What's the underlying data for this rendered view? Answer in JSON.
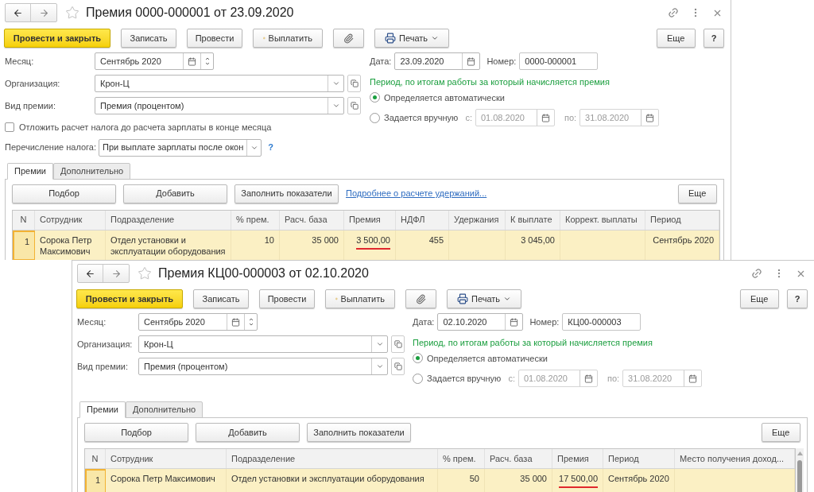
{
  "windows": [
    {
      "title": "Премия 0000-000001 от 23.09.2020",
      "toolbar": [
        {
          "kind": "primary",
          "label": "Провести и закрыть"
        },
        {
          "kind": "plain",
          "label": "Записать"
        },
        {
          "kind": "plain",
          "label": "Провести"
        },
        {
          "kind": "pay",
          "label": "Выплатить"
        },
        {
          "kind": "attach"
        },
        {
          "kind": "print",
          "label": "Печать"
        }
      ],
      "more": "Еще",
      "help": "?",
      "fields": [
        {
          "kind": "month",
          "label": "Месяц:",
          "value": "Сентябрь 2020"
        },
        {
          "kind": "ref",
          "label": "Организация:",
          "value": "Крон-Ц"
        },
        {
          "kind": "ref",
          "label": "Вид премии:",
          "value": "Премия (процентом)"
        }
      ],
      "checkbox": {
        "label": "Отложить расчет налога до расчета зарплаты в конце месяца",
        "checked": false
      },
      "tax_transfer": {
        "label": "Перечисление налога:",
        "value": "При выплате зарплаты после окон",
        "help": "?"
      },
      "date": {
        "label": "Дата:",
        "value": "23.09.2020"
      },
      "number": {
        "label": "Номер:",
        "value": "0000-000001"
      },
      "period": {
        "heading": "Период, по итогам работы за который начисляется премия",
        "options": [
          {
            "label": "Определяется автоматически",
            "selected": true
          },
          {
            "label": "Задается вручную",
            "selected": false
          }
        ],
        "from_label": "с:",
        "from": "01.08.2020",
        "to_label": "по:",
        "to": "31.08.2020"
      },
      "tabs": [
        {
          "label": "Премии",
          "selected": true
        },
        {
          "label": "Дополнительно",
          "selected": false
        }
      ],
      "table_buttons": [
        "Подбор",
        "Добавить",
        "Заполнить показатели"
      ],
      "link": "Подробнее о расчете удержаний...",
      "table_more": "Еще",
      "table": {
        "columns": [
          {
            "label": "N",
            "underlined": false
          },
          {
            "label": "Сотрудник",
            "underlined": false
          },
          {
            "label": "Подразделение",
            "underlined": false
          },
          {
            "label": "% прем.",
            "underlined": false
          },
          {
            "label": "Расч. база",
            "underlined": false
          },
          {
            "label": "Премия",
            "underlined": true
          },
          {
            "label": "НДФЛ",
            "underlined": false
          },
          {
            "label": "Удержания",
            "underlined": false
          },
          {
            "label": "К выплате",
            "underlined": false
          },
          {
            "label": "Коррект. выплаты",
            "underlined": false
          },
          {
            "label": "Период",
            "underlined": false
          }
        ],
        "rows": [
          {
            "selected": true,
            "cells": [
              "1",
              "Сорока Петр Максимович",
              "Отдел установки и эксплуатации оборудования",
              "10",
              "35 000",
              "3 500,00",
              "455",
              "",
              "3 045,00",
              "",
              "Сентябрь 2020"
            ]
          }
        ]
      }
    },
    {
      "title": "Премия КЦ00-000003 от 02.10.2020",
      "toolbar": [
        {
          "kind": "primary",
          "label": "Провести и закрыть"
        },
        {
          "kind": "plain",
          "label": "Записать"
        },
        {
          "kind": "plain",
          "label": "Провести"
        },
        {
          "kind": "pay",
          "label": "Выплатить"
        },
        {
          "kind": "attach"
        },
        {
          "kind": "print",
          "label": "Печать"
        }
      ],
      "more": "Еще",
      "help": "?",
      "fields": [
        {
          "kind": "month",
          "label": "Месяц:",
          "value": "Сентябрь 2020"
        },
        {
          "kind": "ref",
          "label": "Организация:",
          "value": "Крон-Ц"
        },
        {
          "kind": "ref",
          "label": "Вид премии:",
          "value": "Премия (процентом)"
        }
      ],
      "date": {
        "label": "Дата:",
        "value": "02.10.2020"
      },
      "number": {
        "label": "Номер:",
        "value": "КЦ00-000003"
      },
      "period": {
        "heading": "Период, по итогам работы за который начисляется премия",
        "options": [
          {
            "label": "Определяется автоматически",
            "selected": true
          },
          {
            "label": "Задается вручную",
            "selected": false
          }
        ],
        "from_label": "с:",
        "from": "01.08.2020",
        "to_label": "по:",
        "to": "31.08.2020"
      },
      "tabs": [
        {
          "label": "Премии",
          "selected": true
        },
        {
          "label": "Дополнительно",
          "selected": false
        }
      ],
      "table_buttons": [
        "Подбор",
        "Добавить",
        "Заполнить показатели"
      ],
      "table_more": "Еще",
      "table": {
        "columns": [
          {
            "label": "N",
            "underlined": false
          },
          {
            "label": "Сотрудник",
            "underlined": false
          },
          {
            "label": "Подразделение",
            "underlined": false
          },
          {
            "label": "% прем.",
            "underlined": false
          },
          {
            "label": "Расч. база",
            "underlined": false
          },
          {
            "label": "Премия",
            "underlined": true
          },
          {
            "label": "Период",
            "underlined": false
          },
          {
            "label": "Место получения доход...",
            "underlined": false
          }
        ],
        "rows": [
          {
            "selected": true,
            "cells": [
              "1",
              "Сорока Петр Максимович",
              "Отдел установки и эксплуатации оборудования",
              "50",
              "35 000",
              "17 500,00",
              "Сентябрь 2020",
              ""
            ]
          }
        ]
      }
    }
  ]
}
